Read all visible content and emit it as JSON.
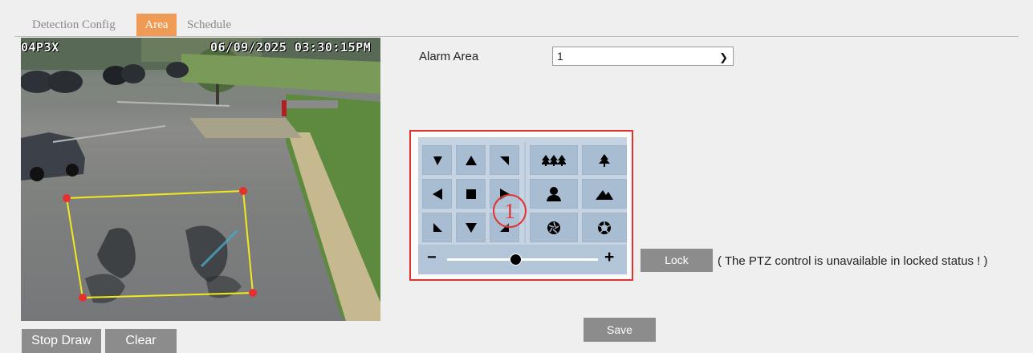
{
  "tabs": [
    {
      "label": "Detection Config",
      "active": false
    },
    {
      "label": "Area",
      "active": true
    },
    {
      "label": "Schedule",
      "active": false
    }
  ],
  "accent_color": "#ef9b55",
  "highlight_color": "#e0332f",
  "video": {
    "osd_name": "04P3X",
    "osd_timestamp": "06/09/2025 03:30:15PM",
    "area_outline_color": "#f2ea1c",
    "area_handle_color": "#e53030"
  },
  "draw_controls": {
    "stop_draw_label": "Stop Draw",
    "clear_label": "Clear"
  },
  "alarm_area": {
    "label": "Alarm Area",
    "selected_value": "1"
  },
  "ptz": {
    "callout_number": "1",
    "direction_icons": [
      "arrow-up-left-icon",
      "arrow-up-icon",
      "arrow-up-right-icon",
      "arrow-left-icon",
      "stop-icon",
      "arrow-right-icon",
      "arrow-down-left-icon",
      "arrow-down-icon",
      "arrow-down-right-icon"
    ],
    "function_icons": [
      "zoom-out-trees-icon",
      "zoom-in-tree-icon",
      "focus-near-person-icon",
      "focus-far-mountain-icon",
      "iris-close-icon",
      "iris-open-icon"
    ],
    "zoom_minus": "−",
    "zoom_plus": "+",
    "zoom_level": 0.45
  },
  "lock": {
    "button_label": "Lock",
    "note": "( The PTZ control is unavailable in locked status ! )"
  },
  "save_label": "Save"
}
